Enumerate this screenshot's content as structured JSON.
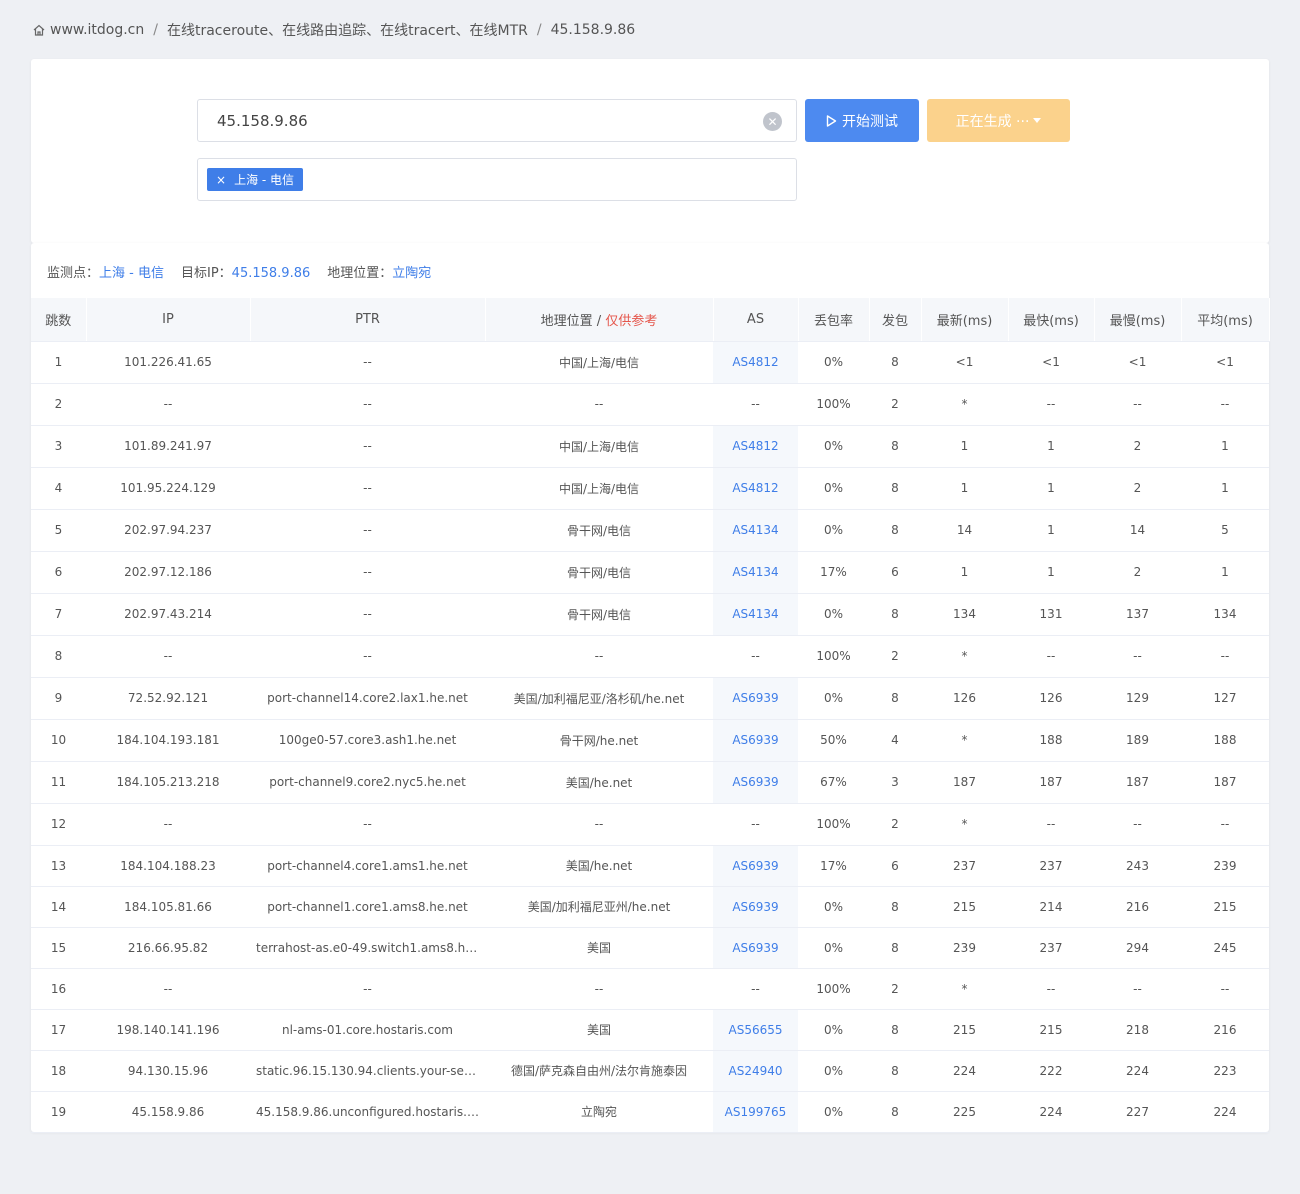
{
  "breadcrumb": {
    "home": "www.itdog.cn",
    "section": "在线traceroute、在线路由追踪、在线tracert、在线MTR",
    "current": "45.158.9.86"
  },
  "form": {
    "ip_value": "45.158.9.86",
    "start_label": "开始测试",
    "generate_label": "正在生成 ···",
    "node_tag": "上海 - 电信"
  },
  "summary": {
    "node_label": "监测点：",
    "node_value": "上海 - 电信",
    "target_label": "目标IP：",
    "target_value": "45.158.9.86",
    "geo_label": "地理位置：",
    "geo_value": "立陶宛"
  },
  "table": {
    "headers": {
      "hop": "跳数",
      "ip": "IP",
      "ptr": "PTR",
      "geo": "地理位置",
      "geo_sep": " / ",
      "geo_note": "仅供参考",
      "as": "AS",
      "loss": "丢包率",
      "sent": "发包",
      "last": "最新(ms)",
      "best": "最快(ms)",
      "worst": "最慢(ms)",
      "avg": "平均(ms)"
    },
    "rows": [
      [
        "1",
        "101.226.41.65",
        "--",
        "中国/上海/电信",
        "AS4812",
        "0%",
        "8",
        "<1",
        "<1",
        "<1",
        "<1"
      ],
      [
        "2",
        "--",
        "--",
        "--",
        "--",
        "100%",
        "2",
        "*",
        "--",
        "--",
        "--"
      ],
      [
        "3",
        "101.89.241.97",
        "--",
        "中国/上海/电信",
        "AS4812",
        "0%",
        "8",
        "1",
        "1",
        "2",
        "1"
      ],
      [
        "4",
        "101.95.224.129",
        "--",
        "中国/上海/电信",
        "AS4812",
        "0%",
        "8",
        "1",
        "1",
        "2",
        "1"
      ],
      [
        "5",
        "202.97.94.237",
        "--",
        "骨干网/电信",
        "AS4134",
        "0%",
        "8",
        "14",
        "1",
        "14",
        "5"
      ],
      [
        "6",
        "202.97.12.186",
        "--",
        "骨干网/电信",
        "AS4134",
        "17%",
        "6",
        "1",
        "1",
        "2",
        "1"
      ],
      [
        "7",
        "202.97.43.214",
        "--",
        "骨干网/电信",
        "AS4134",
        "0%",
        "8",
        "134",
        "131",
        "137",
        "134"
      ],
      [
        "8",
        "--",
        "--",
        "--",
        "--",
        "100%",
        "2",
        "*",
        "--",
        "--",
        "--"
      ],
      [
        "9",
        "72.52.92.121",
        "port-channel14.core2.lax1.he.net",
        "美国/加利福尼亚/洛杉矶/he.net",
        "AS6939",
        "0%",
        "8",
        "126",
        "126",
        "129",
        "127"
      ],
      [
        "10",
        "184.104.193.181",
        "100ge0-57.core3.ash1.he.net",
        "骨干网/he.net",
        "AS6939",
        "50%",
        "4",
        "*",
        "188",
        "189",
        "188"
      ],
      [
        "11",
        "184.105.213.218",
        "port-channel9.core2.nyc5.he.net",
        "美国/he.net",
        "AS6939",
        "67%",
        "3",
        "187",
        "187",
        "187",
        "187"
      ],
      [
        "12",
        "--",
        "--",
        "--",
        "--",
        "100%",
        "2",
        "*",
        "--",
        "--",
        "--"
      ],
      [
        "13",
        "184.104.188.23",
        "port-channel4.core1.ams1.he.net",
        "美国/he.net",
        "AS6939",
        "17%",
        "6",
        "237",
        "237",
        "243",
        "239"
      ],
      [
        "14",
        "184.105.81.66",
        "port-channel1.core1.ams8.he.net",
        "美国/加利福尼亚州/he.net",
        "AS6939",
        "0%",
        "8",
        "215",
        "214",
        "216",
        "215"
      ],
      [
        "15",
        "216.66.95.82",
        "terrahost-as.e0-49.switch1.ams8.he....",
        "美国",
        "AS6939",
        "0%",
        "8",
        "239",
        "237",
        "294",
        "245"
      ],
      [
        "16",
        "--",
        "--",
        "--",
        "--",
        "100%",
        "2",
        "*",
        "--",
        "--",
        "--"
      ],
      [
        "17",
        "198.140.141.196",
        "nl-ams-01.core.hostaris.com",
        "美国",
        "AS56655",
        "0%",
        "8",
        "215",
        "215",
        "218",
        "216"
      ],
      [
        "18",
        "94.130.15.96",
        "static.96.15.130.94.clients.your-serv...",
        "德国/萨克森自由州/法尔肯施泰因",
        "AS24940",
        "0%",
        "8",
        "224",
        "222",
        "224",
        "223"
      ],
      [
        "19",
        "45.158.9.86",
        "45.158.9.86.unconfigured.hostaris.c...",
        "立陶宛",
        "AS199765",
        "0%",
        "8",
        "225",
        "224",
        "227",
        "224"
      ]
    ]
  },
  "colors": {
    "accent": "#3f7ee8",
    "start_button": "#4d8af0",
    "generate_button": "#fbd28c",
    "note": "#e5574c",
    "background": "#eef0f4"
  }
}
